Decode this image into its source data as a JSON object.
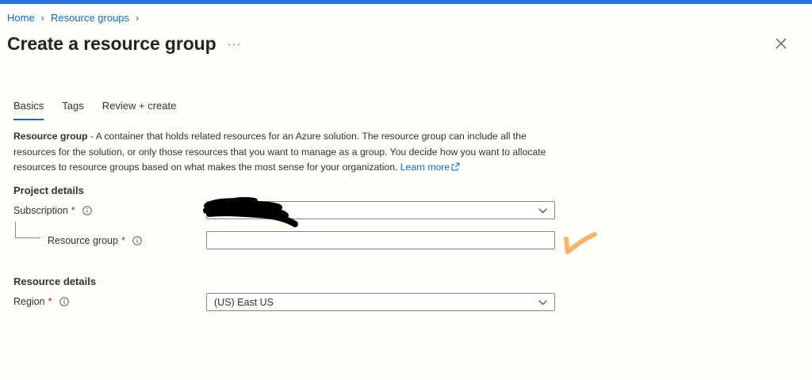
{
  "breadcrumb": {
    "home": "Home",
    "resource_groups": "Resource groups"
  },
  "page": {
    "title": "Create a resource group",
    "more": "···"
  },
  "tabs": [
    {
      "label": "Basics",
      "active": true
    },
    {
      "label": "Tags",
      "active": false
    },
    {
      "label": "Review + create",
      "active": false
    }
  ],
  "description": {
    "bold": "Resource group",
    "text": " - A container that holds related resources for an Azure solution. The resource group can include all the resources for the solution, or only those resources that you want to manage as a group. You decide how you want to allocate resources to resource groups based on what makes the most sense for your organization. ",
    "link": "Learn more"
  },
  "project_details": {
    "title": "Project details",
    "subscription": {
      "label": "Subscription",
      "required": "*",
      "value": ""
    },
    "resource_group": {
      "label": "Resource group",
      "required": "*",
      "value": "",
      "placeholder": ""
    }
  },
  "resource_details": {
    "title": "Resource details",
    "region": {
      "label": "Region",
      "required": "*",
      "value": "(US) East US"
    }
  },
  "colors": {
    "accent": "#0f6cbd",
    "top_bar": "#2e73d8",
    "required": "#a4262c",
    "annotation": "#f5b46a"
  }
}
